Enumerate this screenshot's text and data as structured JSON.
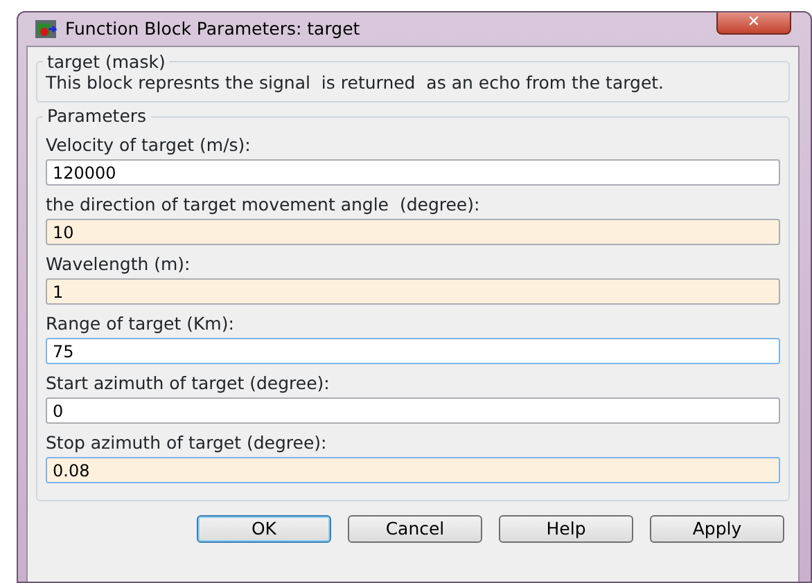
{
  "window": {
    "title": "Function Block Parameters: target",
    "close": "✕"
  },
  "mask": {
    "title": "target (mask)",
    "description": "This block represnts the signal  is returned  as an echo from the target."
  },
  "parameters": {
    "title": "Parameters",
    "fields": [
      {
        "label": "Velocity of target (m/s):",
        "value": "120000",
        "highlighted": false,
        "focused": false
      },
      {
        "label": "the direction of target movement angle  (degree):",
        "value": "10",
        "highlighted": true,
        "focused": false
      },
      {
        "label": "Wavelength (m):",
        "value": "1",
        "highlighted": true,
        "focused": false
      },
      {
        "label": "Range of target (Km):",
        "value": "75",
        "highlighted": false,
        "focused": true
      },
      {
        "label": "Start azimuth of target (degree):",
        "value": "0",
        "highlighted": false,
        "focused": false
      },
      {
        "label": "Stop azimuth of target (degree):",
        "value": "0.08",
        "highlighted": true,
        "focused": true
      }
    ]
  },
  "buttons": [
    {
      "label": "OK",
      "default": true
    },
    {
      "label": "Cancel",
      "default": false
    },
    {
      "label": "Help",
      "default": false
    },
    {
      "label": "Apply",
      "default": false
    }
  ]
}
